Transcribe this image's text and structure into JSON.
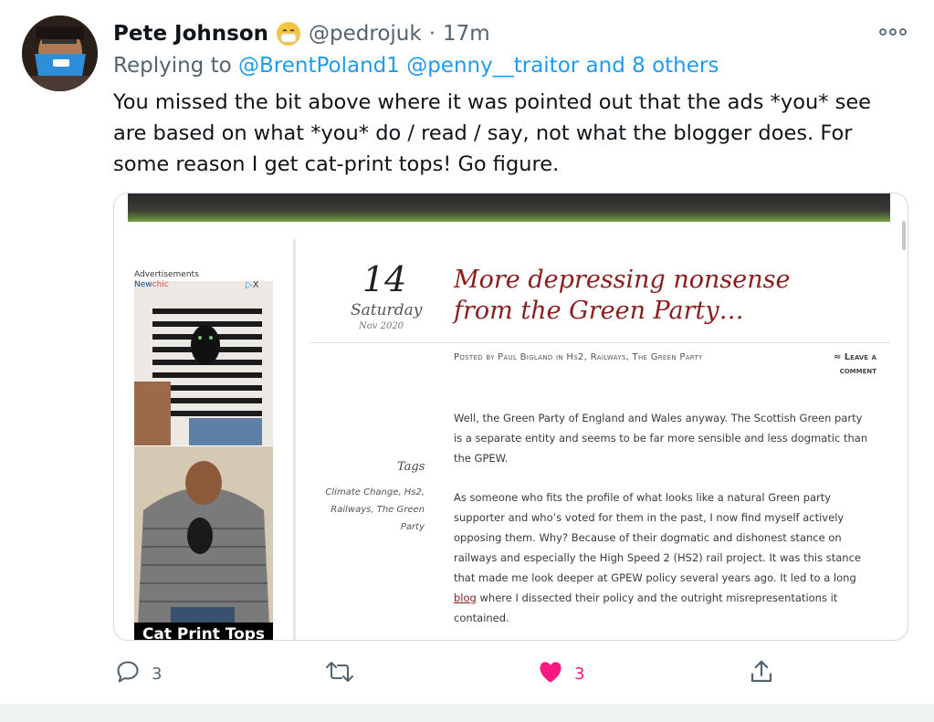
{
  "tweet": {
    "author_name": "Pete Johnson",
    "handle": "@pedrojuk",
    "separator": "·",
    "time": "17m",
    "emoji_icon": "face-with-medical-mask-icon",
    "reply_prefix": "Replying to",
    "reply_to_1": "@BrentPoland1",
    "reply_to_2": "@penny__traitor",
    "reply_to_rest": "and 8 others",
    "text": "You missed the bit above where it was pointed out that the ads *you* see are based on what *you* do / read / say, not what the blogger does. For some reason I get cat-print tops! Go figure."
  },
  "card": {
    "ad": {
      "label": "Advertisements",
      "brand_prefix": "New",
      "brand_suffix": "chic",
      "choices": "▷",
      "close": "X",
      "banner_text": "Cat Print Tops"
    },
    "date": {
      "day_num": "14",
      "weekday": "Saturday",
      "month_year": "Nov 2020"
    },
    "post_title": "More depressing nonsense from the Green Party…",
    "meta": "Posted by Paul Bigland in Hs2, Railways, The Green Party",
    "leave_comment": "≈ Leave a comment",
    "tags_title": "Tags",
    "tags": "Climate Change, Hs2, Railways, The Green Party",
    "paragraph_1": "Well, the Green Party of England and Wales anyway. The Scottish Green party is a separate entity and seems to be far more sensible and less dogmatic than the GPEW.",
    "paragraph_2_before": "As someone who fits the profile of what looks like a natural Green party supporter and who’s voted for them in the past, I now find myself actively opposing them. Why? Because of their dogmatic and dishonest stance on railways and especially the High Speed 2 (HS2) rail project. It was this stance that made me look deeper at GPEW policy several years ago. It led to a long",
    "paragraph_2_link": "blog",
    "paragraph_2_after": "where I dissected their policy and the outright misrepresentations it contained."
  },
  "actions": {
    "reply_count": "3",
    "retweet_count": "",
    "like_count": "3",
    "like_color": "#f91880"
  }
}
